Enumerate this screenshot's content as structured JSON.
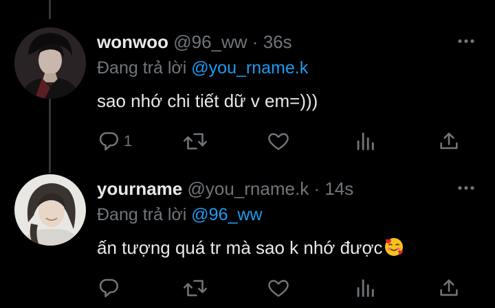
{
  "tweets": [
    {
      "name": "wonwoo",
      "handle": "@96_ww",
      "separator": "·",
      "time": "36s",
      "replying_prefix": "Đang trả lời",
      "replying_to": "@you_rname.k",
      "text": "sao nhớ chi tiết dữ v em=)))",
      "emoji": "",
      "avatar_icon": "dark-portrait-avatar",
      "actions": {
        "reply_count": "1",
        "retweet_count": "",
        "like_count": "",
        "views_count": ""
      }
    },
    {
      "name": "yourname",
      "handle": "@you_rname.k",
      "separator": "·",
      "time": "14s",
      "replying_prefix": "Đang trả lời",
      "replying_to": "@96_ww",
      "text": "ấn tượng quá tr mà sao k nhớ được",
      "emoji": "smiling-face-with-hearts",
      "avatar_icon": "light-portrait-avatar",
      "actions": {
        "reply_count": "",
        "retweet_count": "",
        "like_count": "",
        "views_count": ""
      }
    }
  ],
  "colors": {
    "background": "#000000",
    "text": "#e7e9ea",
    "secondary": "#71767b",
    "accent": "#1d9bf0",
    "thread_line": "#333639"
  }
}
